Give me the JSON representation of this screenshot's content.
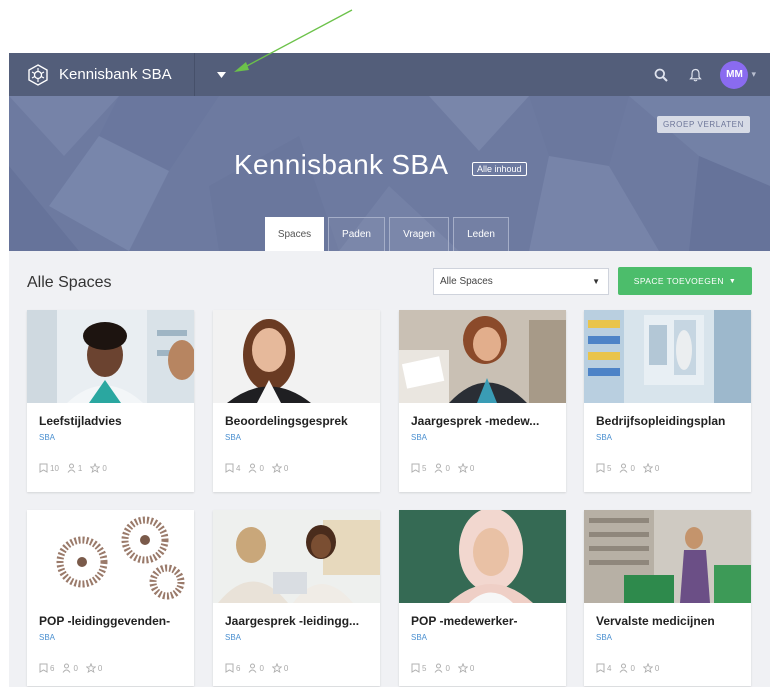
{
  "app": {
    "brand_name": "Kennisbank SBA",
    "avatar_initials": "MM"
  },
  "hero": {
    "leave_button": "GROEP VERLATEN",
    "title": "Kennisbank SBA",
    "badge": "Alle inhoud",
    "tabs": [
      {
        "label": "Spaces",
        "active": true
      },
      {
        "label": "Paden",
        "active": false
      },
      {
        "label": "Vragen",
        "active": false
      },
      {
        "label": "Leden",
        "active": false
      }
    ]
  },
  "main": {
    "section_title": "Alle Spaces",
    "filter_value": "Alle Spaces",
    "add_button": "SPACE TOEVOEGEN"
  },
  "cards": [
    {
      "title": "Leefstijladvies",
      "subtitle": "SBA",
      "pages": "10",
      "members": "1",
      "stars": "0",
      "image": "pharmacist-smiling"
    },
    {
      "title": "Beoordelingsgesprek",
      "subtitle": "SBA",
      "pages": "4",
      "members": "0",
      "stars": "0",
      "image": "woman-portrait"
    },
    {
      "title": "Jaargesprek -medew...",
      "subtitle": "SBA",
      "pages": "5",
      "members": "0",
      "stars": "0",
      "image": "office-meeting"
    },
    {
      "title": "Bedrijfsopleidingsplan",
      "subtitle": "SBA",
      "pages": "5",
      "members": "0",
      "stars": "0",
      "image": "pharmacy-interior"
    },
    {
      "title": "POP -leidinggevenden-",
      "subtitle": "SBA",
      "pages": "6",
      "members": "0",
      "stars": "0",
      "image": "people-gears"
    },
    {
      "title": "Jaargesprek -leidingg...",
      "subtitle": "SBA",
      "pages": "6",
      "members": "0",
      "stars": "0",
      "image": "interview"
    },
    {
      "title": "POP -medewerker-",
      "subtitle": "SBA",
      "pages": "5",
      "members": "0",
      "stars": "0",
      "image": "woman-hijab"
    },
    {
      "title": "Vervalste medicijnen",
      "subtitle": "SBA",
      "pages": "4",
      "members": "0",
      "stars": "0",
      "image": "pharmacy-storage"
    }
  ],
  "colors": {
    "topbar": "#535e7a",
    "hero": "#6d7aa0",
    "accent_green": "#4cbd6b",
    "avatar": "#8a6bf0",
    "link_blue": "#4a8fd0"
  }
}
